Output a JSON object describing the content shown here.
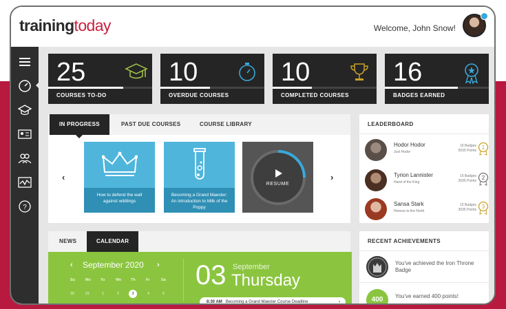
{
  "header": {
    "logo_part1": "training",
    "logo_part2": "today",
    "welcome": "Welcome, John Snow!"
  },
  "sidebar": {
    "items": [
      {
        "icon": "menu-icon"
      },
      {
        "icon": "dashboard-gauge-icon",
        "active": true
      },
      {
        "icon": "graduation-cap-icon"
      },
      {
        "icon": "id-card-icon"
      },
      {
        "icon": "users-icon"
      },
      {
        "icon": "activity-chart-icon"
      },
      {
        "icon": "help-icon"
      }
    ]
  },
  "stats": [
    {
      "value": "25",
      "label": "COURSES TO-DO",
      "icon": "graduation-cap-icon",
      "progress": 0.72
    },
    {
      "value": "10",
      "label": "OVERDUE COURSES",
      "icon": "stopwatch-icon",
      "progress": 0.48
    },
    {
      "value": "10",
      "label": "COMPLETED COURSES",
      "icon": "trophy-icon",
      "progress": 0.38
    },
    {
      "value": "16",
      "label": "BADGES EARNED",
      "icon": "badge-ribbon-icon",
      "progress": 0.7
    }
  ],
  "courses_panel": {
    "tabs": [
      "IN PROGRESS",
      "PAST DUE COURSES",
      "COURSE LIBRARY"
    ],
    "active_tab": 0,
    "cards": [
      {
        "title": "How to defend the wall against wildlings",
        "icon": "crown-icon"
      },
      {
        "title": "Becoming a Grand Maester: An introduction to Milk of the Poppy",
        "icon": "test-tube-icon"
      },
      {
        "title": "RESUME",
        "icon": "play-icon"
      }
    ],
    "prev_label": "‹",
    "next_label": "›"
  },
  "leaderboard": {
    "title": "LEADERBOARD",
    "entries": [
      {
        "name": "Hodor Hodor",
        "sub": "Just Hodor",
        "badges": "16 Badges",
        "points": "5035 Points",
        "rank": "1"
      },
      {
        "name": "Tyrion Lannister",
        "sub": "Hand of the King",
        "badges": "15 Badges",
        "points": "3035 Points",
        "rank": "2"
      },
      {
        "name": "Sansa Stark",
        "sub": "Heiress to the North",
        "badges": "15 Badges",
        "points": "3035 Points",
        "rank": "3"
      }
    ]
  },
  "calendar_panel": {
    "tabs": [
      "NEWS",
      "CALENDAR"
    ],
    "active_tab": 1,
    "month": "September 2020",
    "weekdays": [
      "Su",
      "Mo",
      "Tu",
      "We",
      "Th",
      "Fr",
      "Sa"
    ],
    "days": [
      "30",
      "31",
      "1",
      "2",
      "3",
      "4",
      "5"
    ],
    "selected_day": "3",
    "big_day": "03",
    "big_month": "September",
    "big_weekday": "Thursday",
    "event_time": "8:30 AM",
    "event_text": "Becoming a Grand Maester Course Deadline"
  },
  "achievements": {
    "title": "RECENT ACHIEVEMENTS",
    "items": [
      {
        "text": "You've achieved the Iron Throne Badge",
        "icon": "throne-badge-icon"
      },
      {
        "text": "You've earned 400 points!",
        "icon_text": "400"
      }
    ]
  },
  "colors": {
    "brand_red": "#c8213f",
    "band_red": "#b8193f",
    "dark": "#252525",
    "blue": "#4fb5db",
    "green": "#8bc53f",
    "gold": "#c9a227"
  }
}
